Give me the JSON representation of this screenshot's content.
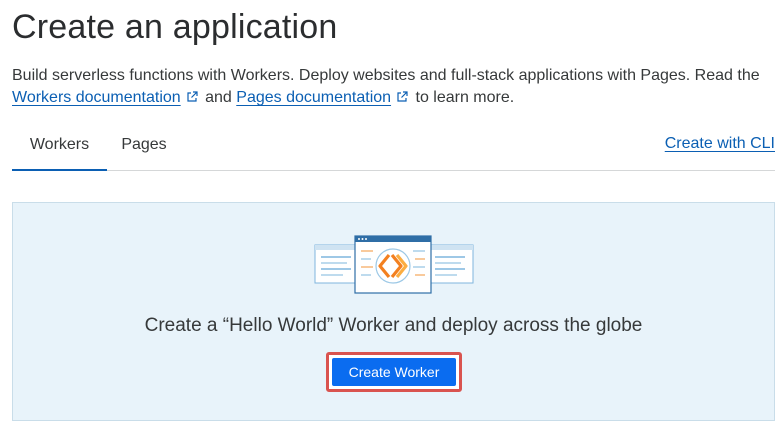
{
  "header": {
    "title": "Create an application"
  },
  "description": {
    "text_before": "Build serverless functions with Workers. Deploy websites and full-stack applications with Pages. Read the ",
    "workers_doc_link": "Workers documentation",
    "text_middle": " and ",
    "pages_doc_link": "Pages documentation",
    "text_after": " to learn more."
  },
  "tabs": [
    {
      "label": "Workers",
      "active": true
    },
    {
      "label": "Pages",
      "active": false
    }
  ],
  "cli_link": "Create with CLI",
  "panel": {
    "cta_text": "Create a “Hello World” Worker and deploy across the globe",
    "button_label": "Create Worker"
  },
  "colors": {
    "link": "#0b5fb3",
    "primary_button": "#0a6cf0",
    "panel_background": "#e8f3fa",
    "highlight_border": "#d9534f",
    "illustration_orange": "#f38020"
  },
  "icons": {
    "external_link": "external-link-icon",
    "illustration": "workers-illustration"
  }
}
